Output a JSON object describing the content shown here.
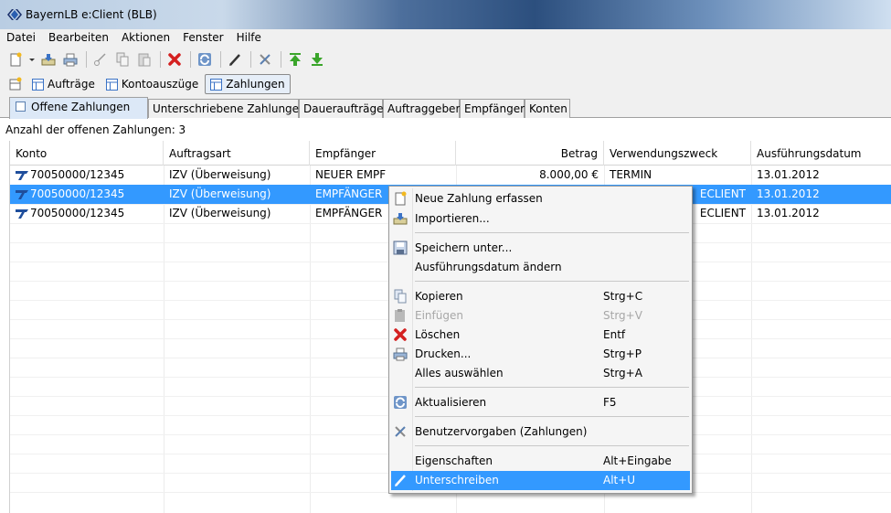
{
  "window": {
    "title": "BayernLB e:Client (BLB)"
  },
  "menubar": {
    "items": [
      "Datei",
      "Bearbeiten",
      "Aktionen",
      "Fenster",
      "Hilfe"
    ]
  },
  "viewbar": {
    "buttons": [
      "Aufträge",
      "Kontoauszüge",
      "Zahlungen"
    ],
    "active": "Zahlungen"
  },
  "tabs": [
    "Offene Zahlungen",
    "Unterschriebene Zahlungen",
    "Daueraufträge",
    "Auftraggeber",
    "Empfänger",
    "Konten"
  ],
  "status": {
    "count_text": "Anzahl der offenen Zahlungen: 3"
  },
  "table": {
    "columns": [
      "Konto",
      "Auftragsart",
      "Empfänger",
      "Betrag",
      "Verwendungszweck",
      "Ausführungsdatum"
    ],
    "rows": [
      {
        "konto": "70050000/12345",
        "auftragsart": "IZV (Überweisung)",
        "empfaenger": "NEUER EMPF",
        "betrag": "8.000,00 €",
        "zweck": "TERMIN",
        "datum": "13.01.2012"
      },
      {
        "konto": "70050000/12345",
        "auftragsart": "IZV (Überweisung)",
        "empfaenger": "EMPFÄNGER",
        "betrag": "",
        "zweck": "ECLIENT",
        "datum": "13.01.2012"
      },
      {
        "konto": "70050000/12345",
        "auftragsart": "IZV (Überweisung)",
        "empfaenger": "EMPFÄNGER",
        "betrag": "",
        "zweck": "ECLIENT",
        "datum": "13.01.2012"
      }
    ]
  },
  "context_menu": {
    "items": [
      {
        "label": "Neue Zahlung erfassen",
        "shortcut": ""
      },
      {
        "label": "Importieren...",
        "shortcut": ""
      },
      {
        "label": "Speichern unter...",
        "shortcut": ""
      },
      {
        "label": "Ausführungsdatum ändern",
        "shortcut": ""
      },
      {
        "label": "Kopieren",
        "shortcut": "Strg+C"
      },
      {
        "label": "Einfügen",
        "shortcut": "Strg+V"
      },
      {
        "label": "Löschen",
        "shortcut": "Entf"
      },
      {
        "label": "Drucken...",
        "shortcut": "Strg+P"
      },
      {
        "label": "Alles auswählen",
        "shortcut": "Strg+A"
      },
      {
        "label": "Aktualisieren",
        "shortcut": "F5"
      },
      {
        "label": "Benutzervorgaben (Zahlungen)",
        "shortcut": ""
      },
      {
        "label": "Eigenschaften",
        "shortcut": "Alt+Eingabe"
      },
      {
        "label": "Unterschreiben",
        "shortcut": "Alt+U"
      }
    ],
    "disabled": [
      "Einfügen"
    ],
    "highlighted": "Unterschreiben"
  },
  "colors": {
    "selection": "#3399ff",
    "delete_red": "#d42020",
    "arrow_green": "#3aa52a",
    "account_icon": "#1f4e9c"
  }
}
